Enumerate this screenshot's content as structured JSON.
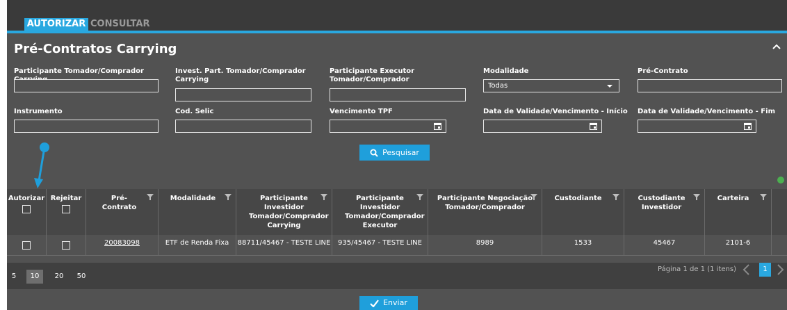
{
  "tabs": {
    "authorize": "AUTORIZAR",
    "consult": "CONSULTAR"
  },
  "panel": {
    "title": "Pré-Contratos Carrying"
  },
  "filters": {
    "participant_borrower": "Participante Tomador/Comprador Carrying",
    "invest_part_borrower": "Invest. Part. Tomador/Comprador Carrying",
    "executor_participant": "Participante Executor Tomador/Comprador",
    "modality": "Modalidade",
    "modality_value": "Todas",
    "pre_contract": "Pré-Contrato",
    "instrument": "Instrumento",
    "selic_code": "Cod. Selic",
    "tpf_maturity": "Vencimento TPF",
    "validity_start": "Data de Validade/Vencimento - Início",
    "validity_end": "Data de Validade/Vencimento - Fim",
    "search_label": "Pesquisar"
  },
  "table": {
    "headers": {
      "authorize": "Autorizar",
      "reject": "Rejeitar",
      "pre_contract": "Pré-Contrato",
      "modality": "Modalidade",
      "part_investor_carrying": "Participante Investidor Tomador/Comprador Carrying",
      "part_investor_executor": "Participante Investidor Tomador/Comprador Executor",
      "part_negotiation": "Participante Negociação Tomador/Comprador",
      "custodian": "Custodiante",
      "custodian_investor": "Custodiante Investidor",
      "portfolio": "Carteira"
    },
    "rows": [
      {
        "pre_contract": "20083098",
        "modality": "ETF de Renda Fixa",
        "part_investor_carrying": "88711/45467 - TESTE LINE",
        "part_investor_executor": "935/45467 - TESTE LINE",
        "part_negotiation": "8989",
        "custodian": "1533",
        "custodian_investor": "45467",
        "portfolio": "2101-6"
      }
    ]
  },
  "pager": {
    "sizes": [
      "5",
      "10",
      "20",
      "50"
    ],
    "selected_size": "10",
    "info": "Página 1 de 1 (1 itens)",
    "current_page": "1"
  },
  "footer": {
    "send_label": "Enviar"
  },
  "colors": {
    "accent": "#29a8e0",
    "panel": "#525252",
    "header": "#474747"
  },
  "icons": [
    "collapse-up-icon",
    "calendar-icon",
    "search-icon",
    "filter-icon",
    "check-icon",
    "chevron-left-icon",
    "chevron-right-icon",
    "export-excel-icon",
    "annotation-arrow"
  ]
}
